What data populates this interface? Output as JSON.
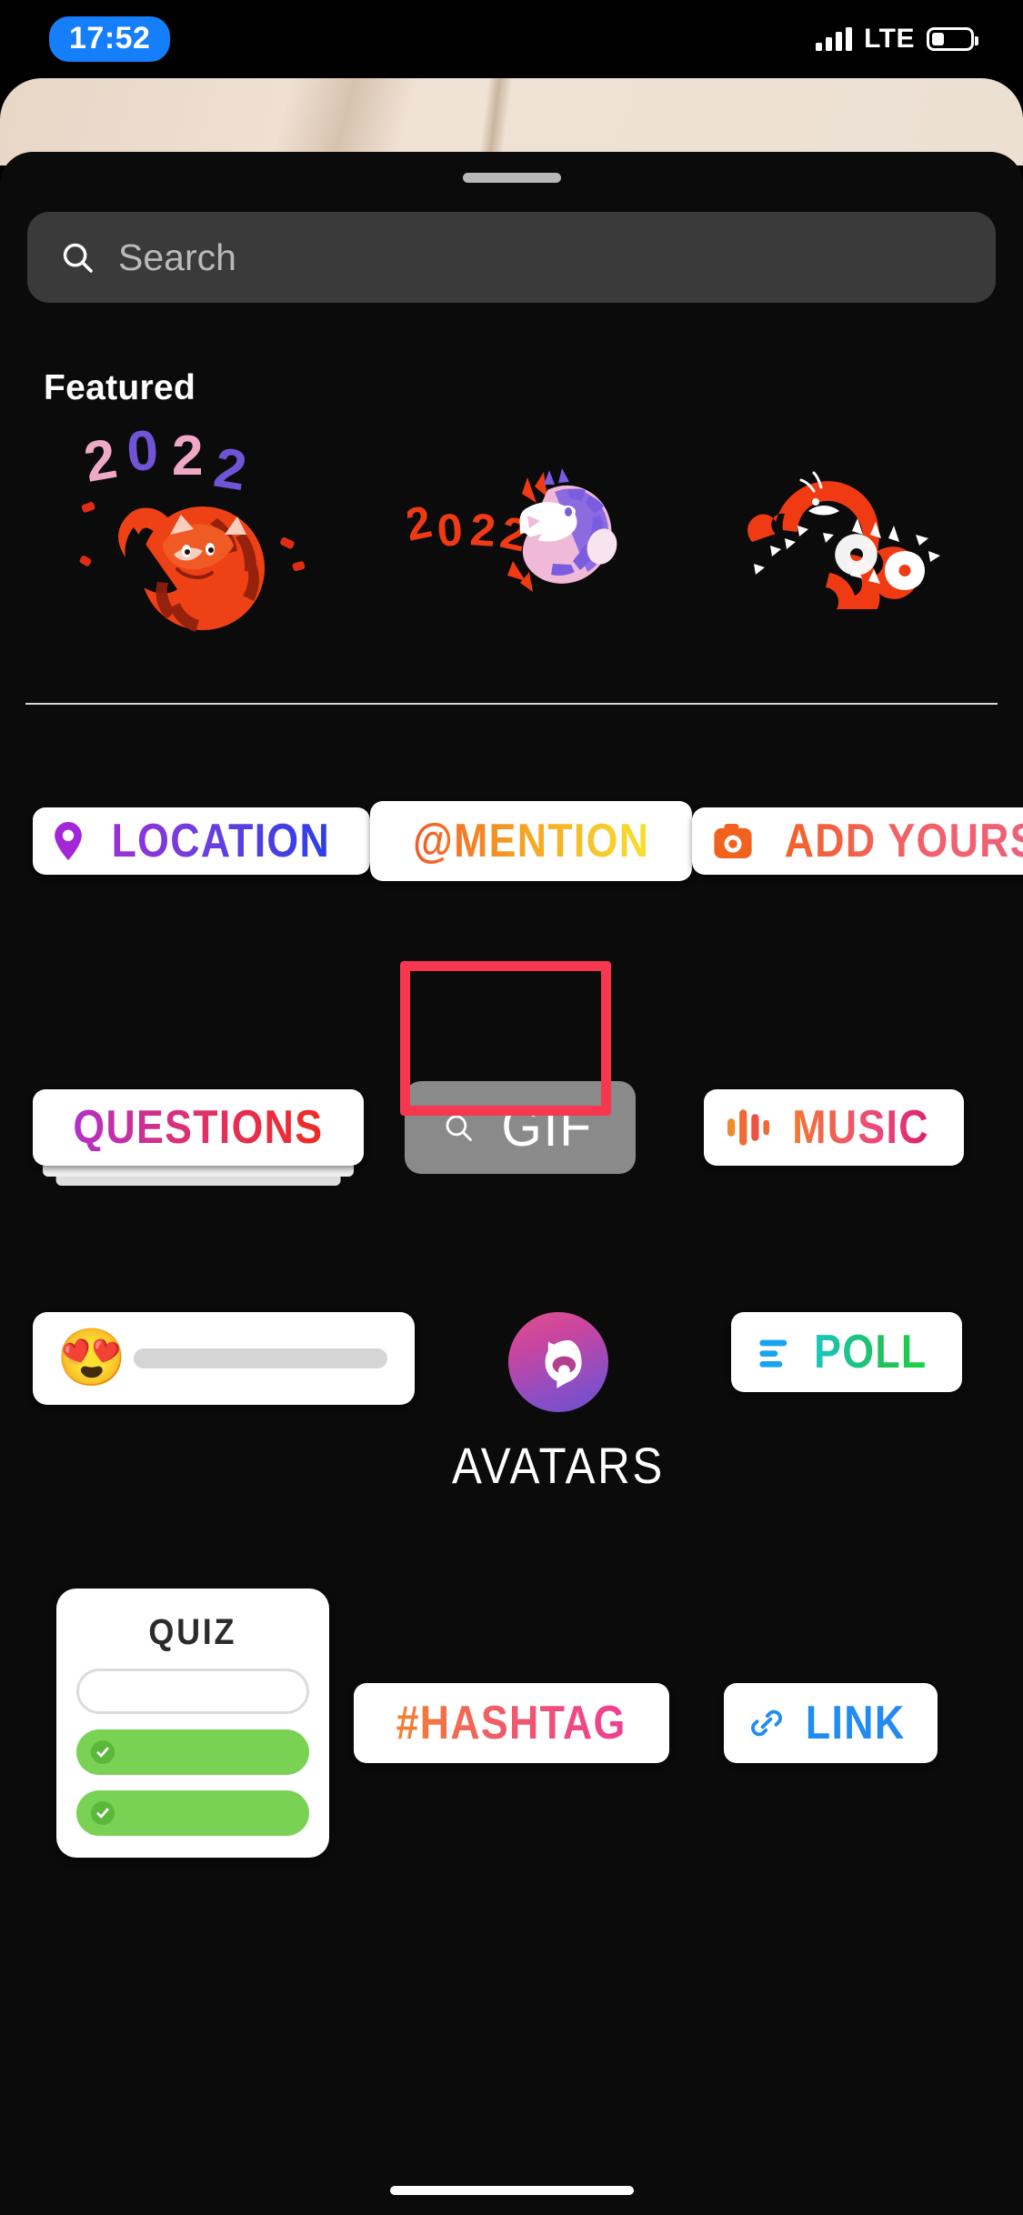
{
  "status_bar": {
    "time": "17:52",
    "network_label": "LTE",
    "signal_icon": "cellular-bars-icon",
    "battery_icon": "battery-icon",
    "battery_level_pct": 32
  },
  "sheet": {
    "grabber_icon": "drag-handle-icon"
  },
  "search": {
    "placeholder": "Search",
    "icon": "search-icon"
  },
  "featured": {
    "title": "Featured",
    "stickers": [
      {
        "name": "tiger-curled-2022-sticker",
        "year": "2022"
      },
      {
        "name": "tiger-roaring-2022-sticker",
        "year": "2022"
      },
      {
        "name": "tiger-leaping-papercut-sticker",
        "year": ""
      }
    ]
  },
  "stickers": {
    "row1": [
      {
        "id": "location",
        "label": "LOCATION",
        "icon": "location-pin-icon"
      },
      {
        "id": "mention",
        "label": "@MENTION",
        "icon": "at-sign-icon"
      },
      {
        "id": "add_yours",
        "label": "ADD YOURS",
        "icon": "camera-icon"
      }
    ],
    "row2": [
      {
        "id": "questions",
        "label": "QUESTIONS",
        "icon": ""
      },
      {
        "id": "gif",
        "label": "GIF",
        "icon": "search-icon"
      },
      {
        "id": "music",
        "label": "MUSIC",
        "icon": "music-bars-icon"
      }
    ],
    "row3": [
      {
        "id": "emoji_slider",
        "label": "",
        "icon": "heart-eyes-emoji",
        "emoji": "😍"
      },
      {
        "id": "avatars",
        "label": "AVATARS",
        "icon": "avatar-glyph-icon"
      },
      {
        "id": "poll",
        "label": "POLL",
        "icon": "poll-bars-icon"
      }
    ],
    "row4": [
      {
        "id": "quiz",
        "label": "QUIZ",
        "icon": "check-icon"
      },
      {
        "id": "hashtag",
        "label": "#HASHTAG",
        "icon": ""
      },
      {
        "id": "link",
        "label": "LINK",
        "icon": "link-chain-icon"
      }
    ]
  },
  "highlight": {
    "target": "music-sticker-button",
    "color": "#f7374f"
  },
  "colors": {
    "sheet_background": "#0b0b0b",
    "search_background": "#3a3a3a",
    "chip_background": "#ffffff",
    "gif_background": "#8a8a8a",
    "accent_time_pill": "#147EFB",
    "highlight_border": "#f7374f",
    "divider": "#d9d9d9"
  }
}
